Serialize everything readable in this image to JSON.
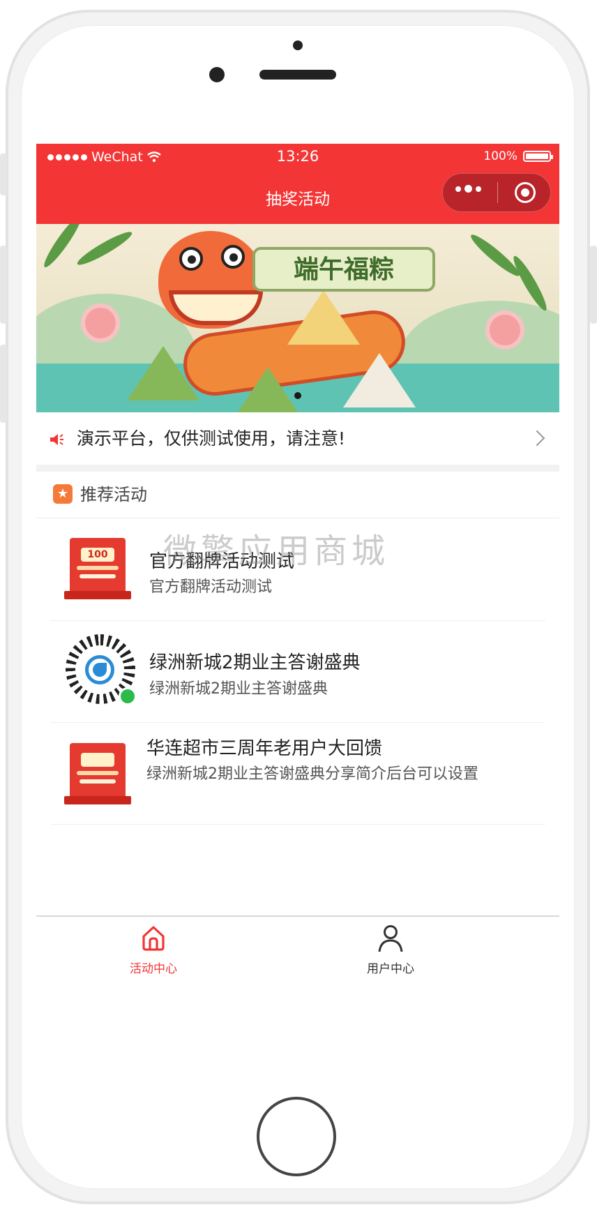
{
  "status_bar": {
    "carrier": "WeChat",
    "time": "13:26",
    "battery": "100%"
  },
  "nav": {
    "title": "抽奖活动",
    "capsule_more_icon": "more-dots-icon",
    "capsule_close_icon": "target-icon"
  },
  "banner": {
    "title": "端午福粽",
    "slide_index": 1,
    "slide_count": 1
  },
  "notice": {
    "icon": "speaker-icon",
    "text": "演示平台，仅供测试使用，请注意!"
  },
  "section": {
    "icon": "star-icon",
    "title": "推荐活动"
  },
  "activities": [
    {
      "title": "官方翻牌活动测试",
      "desc": "官方翻牌活动测试",
      "thumb_type": "poster",
      "thumb_text": "100"
    },
    {
      "title": "绿洲新城2期业主答谢盛典",
      "desc": "绿洲新城2期业主答谢盛典",
      "thumb_type": "qrcode"
    },
    {
      "title": "华连超市三周年老用户大回馈",
      "desc": "绿洲新城2期业主答谢盛典分享简介后台可以设置",
      "thumb_type": "poster",
      "thumb_text": ""
    }
  ],
  "watermark": "微擎应用商城",
  "tabbar": {
    "tabs": [
      {
        "label": "活动中心",
        "icon": "home-icon",
        "active": true
      },
      {
        "label": "用户中心",
        "icon": "user-icon",
        "active": false
      }
    ],
    "active_color": "#f33535",
    "inactive_color": "#333333"
  },
  "colors": {
    "brand": "#f33535",
    "capsule": "#b8242a",
    "section_icon": "#f57a3a"
  }
}
